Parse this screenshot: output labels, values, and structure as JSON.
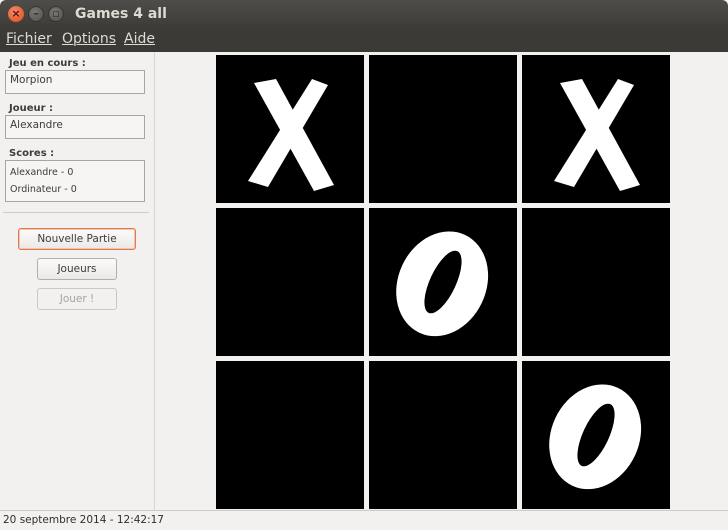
{
  "window": {
    "title": "Games 4 all",
    "close_glyph": "×",
    "min_glyph": "–",
    "max_glyph": "▫"
  },
  "menu": {
    "items": [
      {
        "label": "Fichier"
      },
      {
        "label": "Options"
      },
      {
        "label": "Aide"
      }
    ]
  },
  "sidebar": {
    "current_game_label": "Jeu en cours :",
    "current_game_value": "Morpion",
    "player_label": "Joueur :",
    "player_value": "Alexandre",
    "scores_label": "Scores :",
    "scores": [
      "Alexandre - 0",
      "Ordinateur - 0"
    ],
    "buttons": {
      "new_game": "Nouvelle Partie",
      "players": "Joueurs",
      "play": "Jouer !"
    }
  },
  "board": {
    "cells": [
      "X",
      "",
      "X",
      "",
      "O",
      "",
      "",
      "",
      "O"
    ],
    "colors": {
      "cell_bg": "#000000",
      "mark": "#ffffff"
    }
  },
  "status": {
    "datetime": "20 septembre 2014 - 12:42:17"
  }
}
